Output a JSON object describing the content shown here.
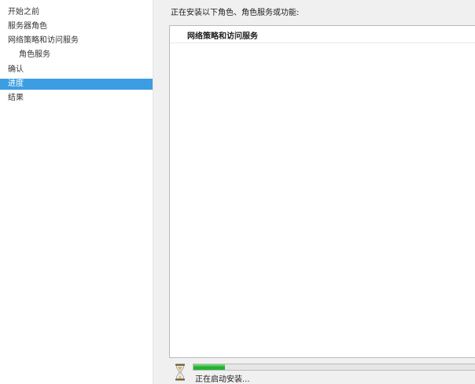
{
  "sidebar": {
    "items": [
      {
        "label": "开始之前",
        "level": 0,
        "active": false
      },
      {
        "label": "服务器角色",
        "level": 0,
        "active": false
      },
      {
        "label": "网络策略和访问服务",
        "level": 0,
        "active": false
      },
      {
        "label": "角色服务",
        "level": 1,
        "active": false
      },
      {
        "label": "确认",
        "level": 0,
        "active": false
      },
      {
        "label": "进度",
        "level": 0,
        "active": true
      },
      {
        "label": "结果",
        "level": 0,
        "active": false
      }
    ]
  },
  "main": {
    "heading": "正在安装以下角色、角色服务或功能:",
    "installing_items": [
      "网络策略和访问服务"
    ],
    "progress": {
      "fraction": 0.11,
      "status": "正在启动安装..."
    }
  },
  "colors": {
    "selection": "#3c9ee2",
    "content_bg": "#f0f0f0",
    "progress_green": "#1fae2f"
  },
  "icons": {
    "status": "hourglass-icon"
  }
}
